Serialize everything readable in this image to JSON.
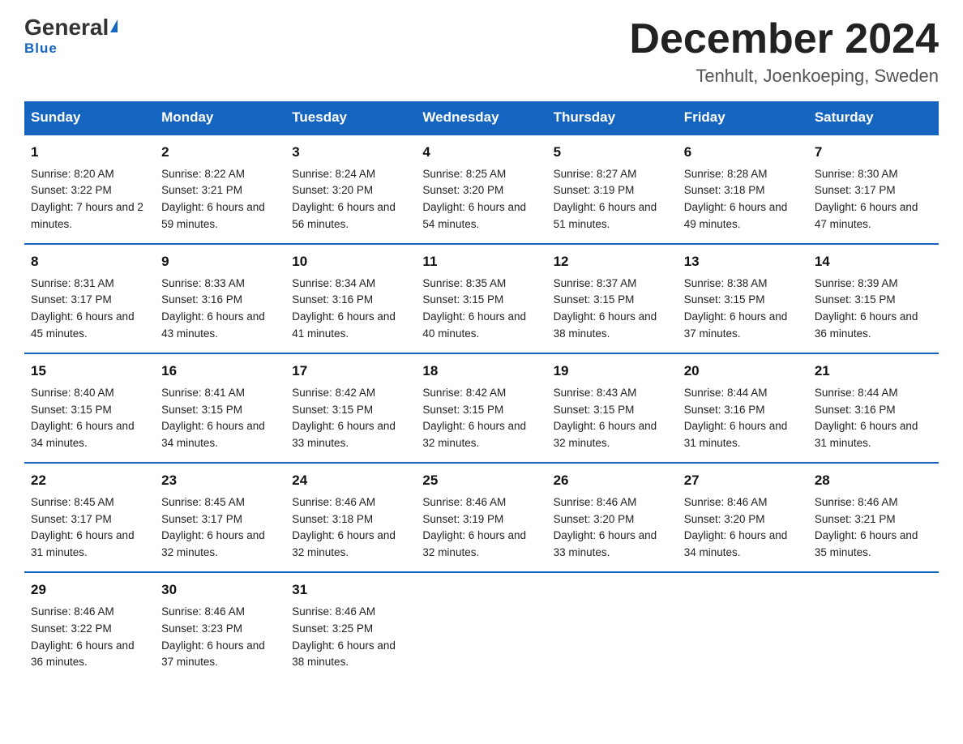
{
  "header": {
    "logo_general": "General",
    "logo_blue": "Blue",
    "month_title": "December 2024",
    "location": "Tenhult, Joenkoeping, Sweden"
  },
  "weekdays": [
    "Sunday",
    "Monday",
    "Tuesday",
    "Wednesday",
    "Thursday",
    "Friday",
    "Saturday"
  ],
  "weeks": [
    [
      {
        "day": "1",
        "sunrise": "8:20 AM",
        "sunset": "3:22 PM",
        "daylight": "7 hours and 2 minutes."
      },
      {
        "day": "2",
        "sunrise": "8:22 AM",
        "sunset": "3:21 PM",
        "daylight": "6 hours and 59 minutes."
      },
      {
        "day": "3",
        "sunrise": "8:24 AM",
        "sunset": "3:20 PM",
        "daylight": "6 hours and 56 minutes."
      },
      {
        "day": "4",
        "sunrise": "8:25 AM",
        "sunset": "3:20 PM",
        "daylight": "6 hours and 54 minutes."
      },
      {
        "day": "5",
        "sunrise": "8:27 AM",
        "sunset": "3:19 PM",
        "daylight": "6 hours and 51 minutes."
      },
      {
        "day": "6",
        "sunrise": "8:28 AM",
        "sunset": "3:18 PM",
        "daylight": "6 hours and 49 minutes."
      },
      {
        "day": "7",
        "sunrise": "8:30 AM",
        "sunset": "3:17 PM",
        "daylight": "6 hours and 47 minutes."
      }
    ],
    [
      {
        "day": "8",
        "sunrise": "8:31 AM",
        "sunset": "3:17 PM",
        "daylight": "6 hours and 45 minutes."
      },
      {
        "day": "9",
        "sunrise": "8:33 AM",
        "sunset": "3:16 PM",
        "daylight": "6 hours and 43 minutes."
      },
      {
        "day": "10",
        "sunrise": "8:34 AM",
        "sunset": "3:16 PM",
        "daylight": "6 hours and 41 minutes."
      },
      {
        "day": "11",
        "sunrise": "8:35 AM",
        "sunset": "3:15 PM",
        "daylight": "6 hours and 40 minutes."
      },
      {
        "day": "12",
        "sunrise": "8:37 AM",
        "sunset": "3:15 PM",
        "daylight": "6 hours and 38 minutes."
      },
      {
        "day": "13",
        "sunrise": "8:38 AM",
        "sunset": "3:15 PM",
        "daylight": "6 hours and 37 minutes."
      },
      {
        "day": "14",
        "sunrise": "8:39 AM",
        "sunset": "3:15 PM",
        "daylight": "6 hours and 36 minutes."
      }
    ],
    [
      {
        "day": "15",
        "sunrise": "8:40 AM",
        "sunset": "3:15 PM",
        "daylight": "6 hours and 34 minutes."
      },
      {
        "day": "16",
        "sunrise": "8:41 AM",
        "sunset": "3:15 PM",
        "daylight": "6 hours and 34 minutes."
      },
      {
        "day": "17",
        "sunrise": "8:42 AM",
        "sunset": "3:15 PM",
        "daylight": "6 hours and 33 minutes."
      },
      {
        "day": "18",
        "sunrise": "8:42 AM",
        "sunset": "3:15 PM",
        "daylight": "6 hours and 32 minutes."
      },
      {
        "day": "19",
        "sunrise": "8:43 AM",
        "sunset": "3:15 PM",
        "daylight": "6 hours and 32 minutes."
      },
      {
        "day": "20",
        "sunrise": "8:44 AM",
        "sunset": "3:16 PM",
        "daylight": "6 hours and 31 minutes."
      },
      {
        "day": "21",
        "sunrise": "8:44 AM",
        "sunset": "3:16 PM",
        "daylight": "6 hours and 31 minutes."
      }
    ],
    [
      {
        "day": "22",
        "sunrise": "8:45 AM",
        "sunset": "3:17 PM",
        "daylight": "6 hours and 31 minutes."
      },
      {
        "day": "23",
        "sunrise": "8:45 AM",
        "sunset": "3:17 PM",
        "daylight": "6 hours and 32 minutes."
      },
      {
        "day": "24",
        "sunrise": "8:46 AM",
        "sunset": "3:18 PM",
        "daylight": "6 hours and 32 minutes."
      },
      {
        "day": "25",
        "sunrise": "8:46 AM",
        "sunset": "3:19 PM",
        "daylight": "6 hours and 32 minutes."
      },
      {
        "day": "26",
        "sunrise": "8:46 AM",
        "sunset": "3:20 PM",
        "daylight": "6 hours and 33 minutes."
      },
      {
        "day": "27",
        "sunrise": "8:46 AM",
        "sunset": "3:20 PM",
        "daylight": "6 hours and 34 minutes."
      },
      {
        "day": "28",
        "sunrise": "8:46 AM",
        "sunset": "3:21 PM",
        "daylight": "6 hours and 35 minutes."
      }
    ],
    [
      {
        "day": "29",
        "sunrise": "8:46 AM",
        "sunset": "3:22 PM",
        "daylight": "6 hours and 36 minutes."
      },
      {
        "day": "30",
        "sunrise": "8:46 AM",
        "sunset": "3:23 PM",
        "daylight": "6 hours and 37 minutes."
      },
      {
        "day": "31",
        "sunrise": "8:46 AM",
        "sunset": "3:25 PM",
        "daylight": "6 hours and 38 minutes."
      },
      null,
      null,
      null,
      null
    ]
  ]
}
